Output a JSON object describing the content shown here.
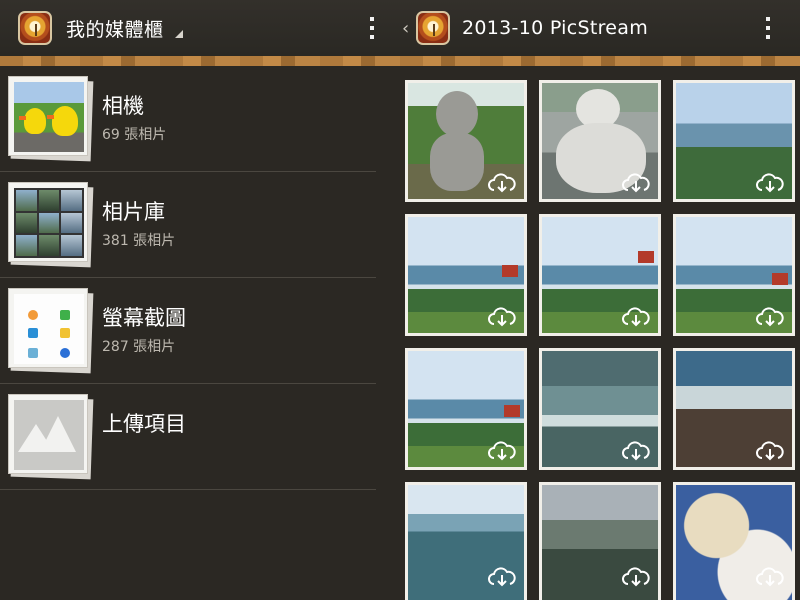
{
  "left_header": {
    "title": "我的媒體櫃"
  },
  "right_header": {
    "title": "2013-10 PicStream"
  },
  "albums": [
    {
      "name": "相機",
      "count": "69 張相片"
    },
    {
      "name": "相片庫",
      "count": "381 張相片"
    },
    {
      "name": "螢幕截圖",
      "count": "287 張相片"
    },
    {
      "name": "上傳項目",
      "count": ""
    }
  ],
  "photos": [
    {
      "subject": "buddha-statue-garden",
      "status_icon": "cloud-download-icon"
    },
    {
      "subject": "buddha-statue-white",
      "status_icon": "cloud-download-icon"
    },
    {
      "subject": "coastal-town",
      "status_icon": "cloud-download-icon"
    },
    {
      "subject": "sea-pavilion",
      "status_icon": "cloud-download-icon"
    },
    {
      "subject": "sea-pavilion",
      "status_icon": "cloud-download-icon"
    },
    {
      "subject": "sea-pavilion",
      "status_icon": "cloud-download-icon"
    },
    {
      "subject": "sea-pavilion",
      "status_icon": "cloud-download-icon"
    },
    {
      "subject": "ocean-waves",
      "status_icon": "cloud-download-icon"
    },
    {
      "subject": "rocky-shore",
      "status_icon": "cloud-download-icon"
    },
    {
      "subject": "open-sea",
      "status_icon": "cloud-download-icon"
    },
    {
      "subject": "bay-view",
      "status_icon": "cloud-download-icon"
    },
    {
      "subject": "food-plates",
      "status_icon": "cloud-download-icon"
    }
  ]
}
